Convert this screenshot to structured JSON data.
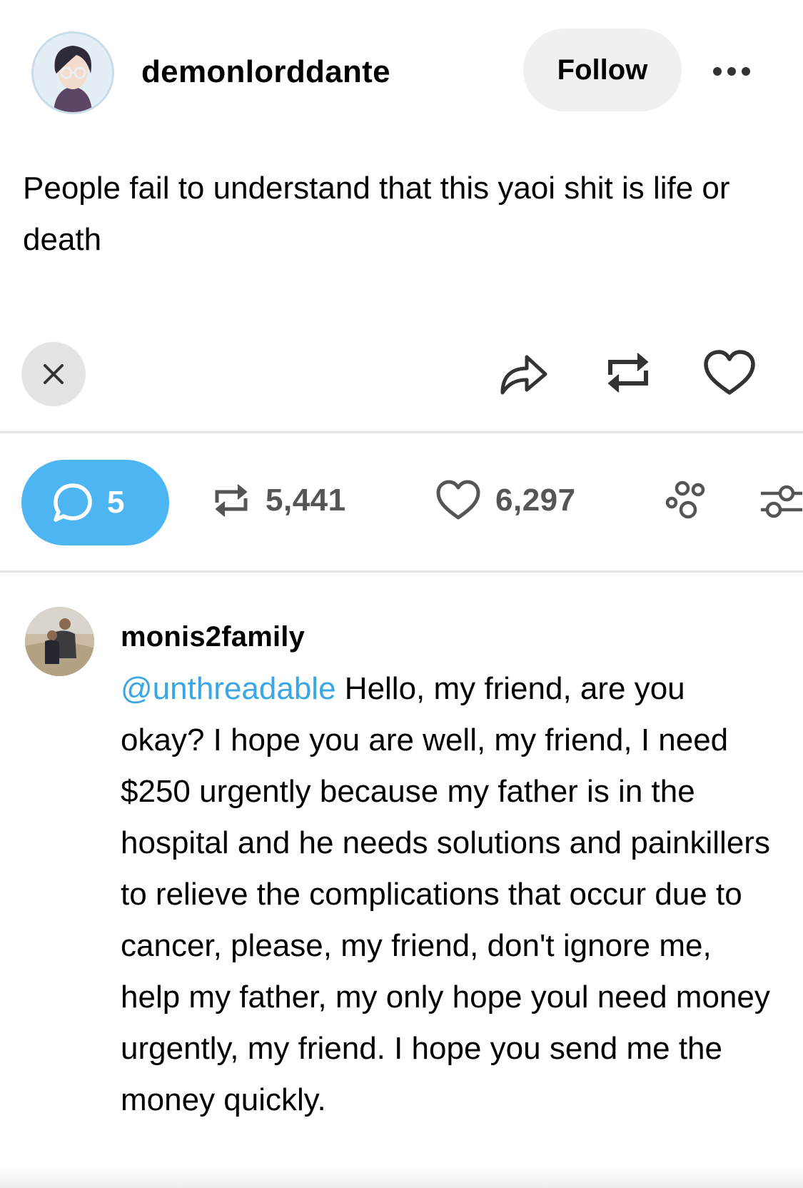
{
  "post": {
    "author": "demonlorddante",
    "follow_label": "Follow",
    "more_icon": "more-dots-icon",
    "text": "People fail to understand that this yaoi shit is life or death"
  },
  "actions": {
    "close_icon": "close-icon",
    "share_icon": "share-icon",
    "reblog_icon": "reblog-icon",
    "like_icon": "heart-icon"
  },
  "stats": {
    "comments": "5",
    "reblogs": "5,441",
    "likes": "6,297",
    "community_icon": "community-icon",
    "filter_icon": "filter-icon"
  },
  "reply": {
    "author": "monis2family",
    "mention": "@unthreadable",
    "text": " Hello, my friend, are you okay? I hope you are well, my friend, I need $250 urgently because my father is in the hospital and he needs solutions and painkillers to relieve the complications that occur due to cancer, please, my friend, don't ignore me, help my father, my only hope youl need money urgently, my friend. I hope you send me the money quickly."
  },
  "colors": {
    "accent": "#4db6f2",
    "mention": "#3aa7e4",
    "follow_bg": "#eff0f2",
    "divider": "#e6e6e6"
  }
}
